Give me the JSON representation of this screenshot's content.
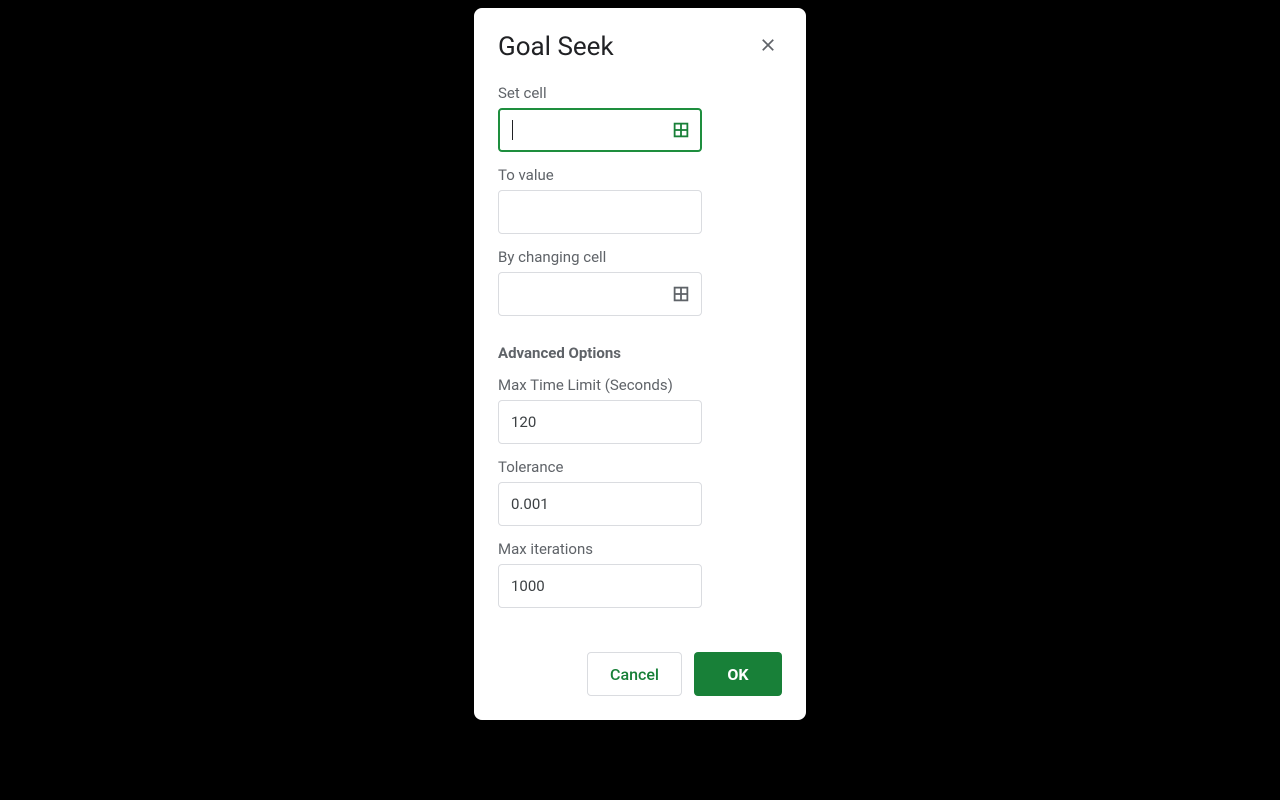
{
  "dialog": {
    "title": "Goal Seek",
    "fields": {
      "set_cell": {
        "label": "Set cell",
        "value": ""
      },
      "to_value": {
        "label": "To value",
        "value": ""
      },
      "by_changing_cell": {
        "label": "By changing cell",
        "value": ""
      }
    },
    "advanced": {
      "heading": "Advanced Options",
      "max_time_limit": {
        "label": "Max Time Limit (Seconds)",
        "value": "120"
      },
      "tolerance": {
        "label": "Tolerance",
        "value": "0.001"
      },
      "max_iterations": {
        "label": "Max iterations",
        "value": "1000"
      }
    },
    "buttons": {
      "cancel": "Cancel",
      "ok": "OK"
    }
  },
  "colors": {
    "accent": "#188038",
    "focus_border": "#1e8e3e"
  }
}
